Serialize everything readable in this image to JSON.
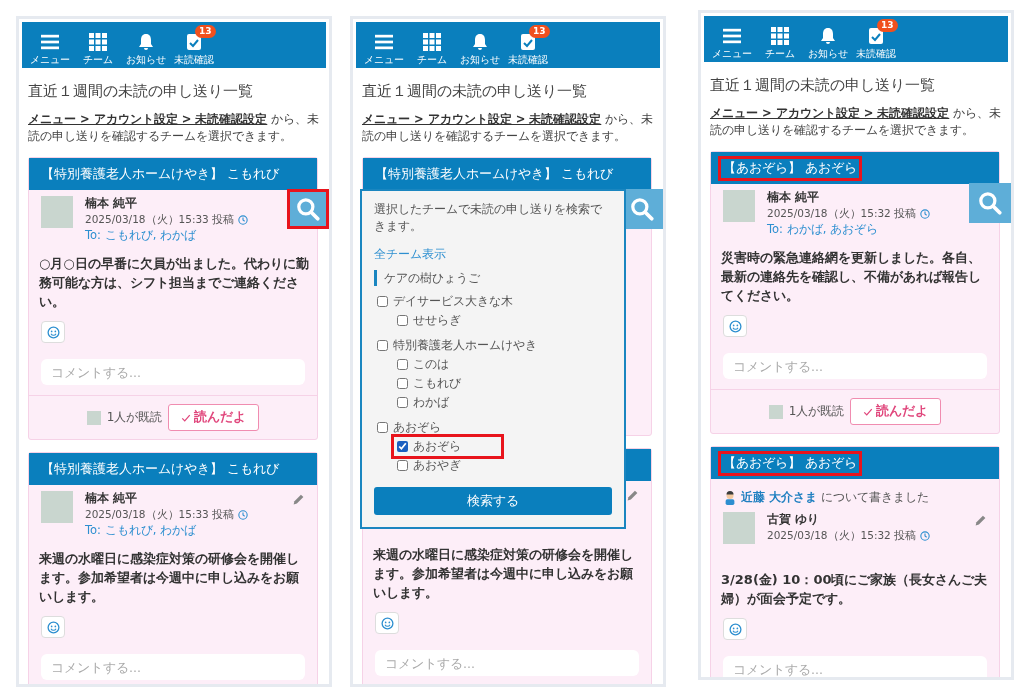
{
  "phones": [
    {
      "nav": [
        {
          "label": "メニュー"
        },
        {
          "label": "チーム"
        },
        {
          "label": "お知らせ"
        },
        {
          "label": "未読確認",
          "badge": "13"
        }
      ],
      "title": "直近１週間の未読の申し送り一覧",
      "intro": {
        "link": "メニュー > アカウント設定 > 未読確認設定",
        "text": "から、未読の申し送りを確認するチームを選択できます。"
      },
      "search_button": {
        "highlighted": true
      },
      "posts": [
        {
          "team": "【特別養護老人ホームけやき】 こもれび",
          "team_highlighted": false,
          "author": {
            "name": "楠本 純平",
            "date": "2025/03/18（火）15:33 投稿",
            "to": "To: こもれび, わかば"
          },
          "body": "○月○日の早番に欠員が出ました。代わりに勤務可能な方は、シフト担当までご連絡ください。",
          "comment_placeholder": "コメントする...",
          "footer": {
            "read_count": "1人が既読",
            "button": "読んだよ"
          }
        },
        {
          "team": "【特別養護老人ホームけやき】 こもれび",
          "team_highlighted": false,
          "editable": true,
          "author": {
            "name": "楠本 純平",
            "date": "2025/03/18（火）15:33 投稿",
            "to": "To: こもれび, わかば"
          },
          "body": "来週の水曜日に感染症対策の研修会を開催します。参加希望者は今週中に申し込みをお願いします。",
          "comment_placeholder": "コメントする..."
        }
      ]
    },
    {
      "nav": [
        {
          "label": "メニュー"
        },
        {
          "label": "チーム"
        },
        {
          "label": "お知らせ"
        },
        {
          "label": "未読確認",
          "badge": "13"
        }
      ],
      "title": "直近１週間の未読の申し送り一覧",
      "intro": {
        "link": "メニュー > アカウント設定 > 未読確認設定",
        "text": "から、未読の申し送りを確認するチームを選択できます。"
      },
      "search_button": {
        "highlighted": false
      },
      "posts": [
        {
          "team": "【特別養護老人ホームけやき】 こもれび",
          "team_highlighted": false
        },
        {
          "editable": true,
          "body": "来週の水曜日に感染症対策の研修会を開催します。参加希望者は今週中に申し込みをお願いします。",
          "comment_placeholder": "コメントする..."
        }
      ],
      "search_popup": {
        "description": "選択したチームで未読の申し送りを検索できます。",
        "show_all": "全チーム表示",
        "teams": [
          {
            "kind": "org",
            "label": "ケアの樹ひょうご"
          },
          {
            "kind": "team",
            "label": "デイサービス大きな木",
            "checked": false,
            "highlighted": false,
            "children": [
              {
                "label": "せせらぎ",
                "checked": false,
                "highlighted": false
              }
            ]
          },
          {
            "kind": "team",
            "label": "特別養護老人ホームけやき",
            "checked": false,
            "highlighted": false,
            "children": [
              {
                "label": "このは",
                "checked": false,
                "highlighted": false
              },
              {
                "label": "こもれび",
                "checked": false,
                "highlighted": false
              },
              {
                "label": "わかば",
                "checked": false,
                "highlighted": false
              }
            ]
          },
          {
            "kind": "team",
            "label": "あおぞら",
            "checked": false,
            "highlighted": false,
            "children": [
              {
                "label": "あおぞら",
                "checked": true,
                "highlighted": true
              },
              {
                "label": "あおやぎ",
                "checked": false,
                "highlighted": false
              }
            ]
          }
        ],
        "button": "検索する"
      }
    },
    {
      "nav": [
        {
          "label": "メニュー"
        },
        {
          "label": "チーム"
        },
        {
          "label": "お知らせ"
        },
        {
          "label": "未読確認",
          "badge": "13"
        }
      ],
      "title": "直近１週間の未読の申し送り一覧",
      "intro": {
        "link": "メニュー > アカウント設定 > 未読確認設定",
        "text": "から、未読の申し送りを確認するチームを選択できます。"
      },
      "search_button": {
        "highlighted": false
      },
      "posts": [
        {
          "team": "【あおぞら】 あおぞら",
          "team_highlighted": true,
          "author": {
            "name": "楠本 純平",
            "date": "2025/03/18（火）15:32 投稿",
            "to": "To: わかば, あおぞら"
          },
          "body": "災害時の緊急連絡網を更新しました。各自、最新の連絡先を確認し、不備があれば報告してください。",
          "comment_placeholder": "コメントする...",
          "footer": {
            "read_count": "1人が既読",
            "button": "読んだよ"
          }
        },
        {
          "team": "【あおぞら】 あおぞら",
          "team_highlighted": true,
          "about": {
            "person": "近藤 大介さま",
            "text": "について書きました"
          },
          "editable": true,
          "author": {
            "name": "古賀 ゆり",
            "date": "2025/03/18（火）15:32 投稿"
          },
          "body": "3/28(金) 10：00頃にご家族（長女さんご夫婦）が面会予定です。",
          "comment_placeholder": "コメントする..."
        }
      ]
    }
  ]
}
